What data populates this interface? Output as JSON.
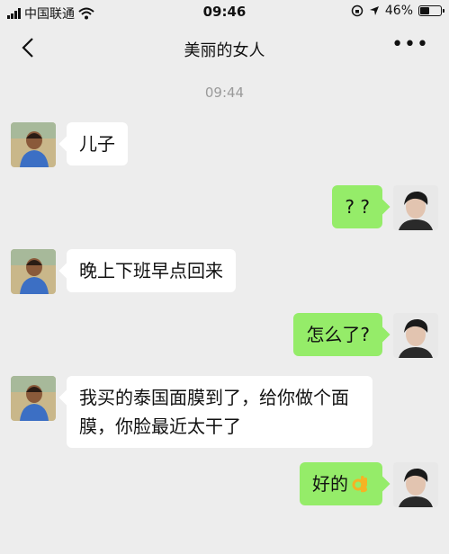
{
  "status": {
    "carrier": "中国联通",
    "time": "09:46",
    "battery": "46%",
    "battery_level": 0.46
  },
  "nav": {
    "title": "美丽的女人"
  },
  "time_separator": "09:44",
  "messages": [
    {
      "side": "left",
      "text": "儿子"
    },
    {
      "side": "right",
      "text": "? ?"
    },
    {
      "side": "left",
      "text": "晚上下班早点回来"
    },
    {
      "side": "right",
      "text": "怎么了?"
    },
    {
      "side": "left",
      "text": "我买的泰国面膜到了，给你做个面膜，你脸最近太干了"
    },
    {
      "side": "right",
      "text": "好的",
      "emoji": "ok-hand-icon"
    }
  ],
  "colors": {
    "background": "#ededed",
    "sent_bubble": "#95ec69",
    "received_bubble": "#ffffff"
  }
}
